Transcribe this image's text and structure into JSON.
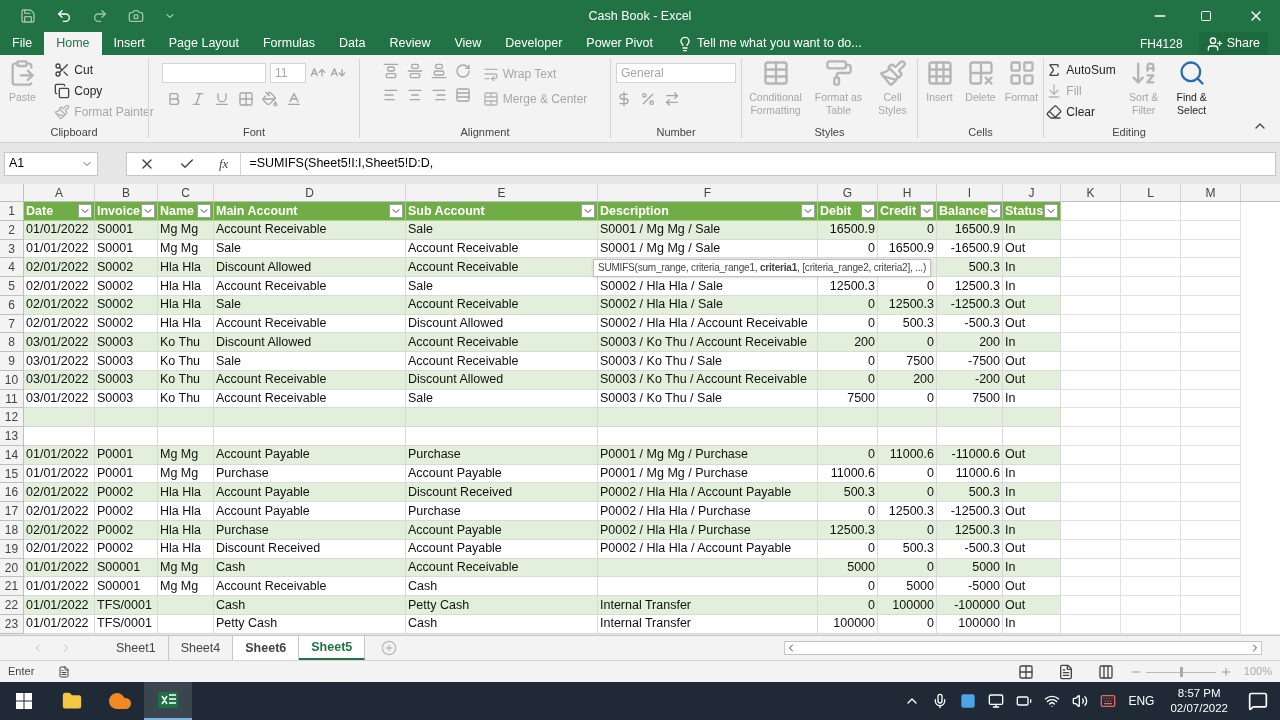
{
  "window": {
    "title": "Cash Book - Excel",
    "user": "FH4128",
    "share": "Share"
  },
  "ribbon_tabs": [
    {
      "label": "File",
      "selected": false
    },
    {
      "label": "Home",
      "selected": true
    },
    {
      "label": "Insert",
      "selected": false
    },
    {
      "label": "Page Layout",
      "selected": false
    },
    {
      "label": "Formulas",
      "selected": false
    },
    {
      "label": "Data",
      "selected": false
    },
    {
      "label": "Review",
      "selected": false
    },
    {
      "label": "View",
      "selected": false
    },
    {
      "label": "Developer",
      "selected": false
    },
    {
      "label": "Power Pivot",
      "selected": false
    }
  ],
  "tell_me": {
    "placeholder": "Tell me what you want to do..."
  },
  "ribbon": {
    "clipboard": {
      "label": "Clipboard",
      "paste": {
        "label": "Paste",
        "disabled": true
      },
      "items": [
        {
          "label": "Cut",
          "disabled": false
        },
        {
          "label": "Copy",
          "disabled": false
        },
        {
          "label": "Format Painter",
          "disabled": true
        }
      ]
    },
    "font": {
      "label": "Font",
      "size": "11"
    },
    "alignment": {
      "label": "Alignment",
      "items": [
        {
          "label": "Wrap Text",
          "disabled": true
        },
        {
          "label": "Merge & Center",
          "disabled": true
        }
      ]
    },
    "number": {
      "label": "Number",
      "format": "General"
    },
    "styles": {
      "label": "Styles",
      "items": [
        {
          "label": "Conditional Formatting",
          "disabled": true
        },
        {
          "label": "Format as Table",
          "disabled": true
        },
        {
          "label": "Cell Styles",
          "disabled": true
        }
      ]
    },
    "cells": {
      "label": "Cells",
      "items": [
        {
          "label": "Insert",
          "disabled": true
        },
        {
          "label": "Delete",
          "disabled": true
        },
        {
          "label": "Format",
          "disabled": true
        }
      ]
    },
    "editing": {
      "label": "Editing",
      "small": [
        {
          "label": "AutoSum",
          "disabled": false
        },
        {
          "label": "Fill",
          "disabled": true
        },
        {
          "label": "Clear",
          "disabled": false
        }
      ],
      "large": [
        {
          "label": "Sort & Filter",
          "disabled": true
        },
        {
          "label": "Find & Select",
          "disabled": false
        }
      ]
    }
  },
  "formula_bar": {
    "name_box": "A1",
    "fx": "fx",
    "formula": "=SUMIFS(Sheet5!I:I,Sheet5!D:D,"
  },
  "columns": [
    "A",
    "B",
    "C",
    "D",
    "E",
    "F",
    "G",
    "H",
    "I",
    "J",
    "K",
    "L",
    "M"
  ],
  "header_row": {
    "n": "1",
    "cells": [
      "Date",
      "Invoice",
      "Name",
      "Main Account",
      "Sub Account",
      "Description",
      "Debit",
      "Credit",
      "Balance",
      "Status"
    ]
  },
  "rows": [
    {
      "n": "2",
      "cells": [
        "01/01/2022",
        "S0001",
        "Mg Mg",
        "Account Receivable",
        "Sale",
        "S0001 / Mg Mg / Sale",
        "16500.9",
        "0",
        "16500.9",
        "In"
      ]
    },
    {
      "n": "3",
      "cells": [
        "01/01/2022",
        "S0001",
        "Mg Mg",
        "Sale",
        "Account Receivable",
        "S0001 / Mg Mg / Sale",
        "0",
        "16500.9",
        "-16500.9",
        "Out"
      ]
    },
    {
      "n": "4",
      "cells": [
        "02/01/2022",
        "S0002",
        "Hla Hla",
        "Discount Allowed",
        "Account Receivable",
        null,
        null,
        null,
        "500.3",
        "In"
      ]
    },
    {
      "n": "5",
      "cells": [
        "02/01/2022",
        "S0002",
        "Hla Hla",
        "Account Receivable",
        "Sale",
        "S0002 / Hla Hla / Sale",
        "12500.3",
        "0",
        "12500.3",
        "In"
      ]
    },
    {
      "n": "6",
      "cells": [
        "02/01/2022",
        "S0002",
        "Hla Hla",
        "Sale",
        "Account Receivable",
        "S0002 / Hla Hla / Sale",
        "0",
        "12500.3",
        "-12500.3",
        "Out"
      ]
    },
    {
      "n": "7",
      "cells": [
        "02/01/2022",
        "S0002",
        "Hla Hla",
        "Account Receivable",
        "Discount Allowed",
        "S0002 / Hla Hla / Account Receivable",
        "0",
        "500.3",
        "-500.3",
        "Out"
      ]
    },
    {
      "n": "8",
      "cells": [
        "03/01/2022",
        "S0003",
        "Ko Thu",
        "Discount Allowed",
        "Account Receivable",
        "S0003 / Ko Thu / Account Receivable",
        "200",
        "0",
        "200",
        "In"
      ]
    },
    {
      "n": "9",
      "cells": [
        "03/01/2022",
        "S0003",
        "Ko Thu",
        "Sale",
        "Account Receivable",
        "S0003 / Ko Thu / Sale",
        "0",
        "7500",
        "-7500",
        "Out"
      ]
    },
    {
      "n": "10",
      "cells": [
        "03/01/2022",
        "S0003",
        "Ko Thu",
        "Account Receivable",
        "Discount Allowed",
        "S0003 / Ko Thu / Account Receivable",
        "0",
        "200",
        "-200",
        "Out"
      ]
    },
    {
      "n": "11",
      "cells": [
        "03/01/2022",
        "S0003",
        "Ko Thu",
        "Account Receivable",
        "Sale",
        "S0003 / Ko Thu / Sale",
        "7500",
        "0",
        "7500",
        "In"
      ]
    },
    {
      "n": "12",
      "cells": [
        null,
        null,
        null,
        null,
        null,
        null,
        null,
        null,
        null,
        null
      ]
    },
    {
      "n": "13",
      "cells": [
        null,
        null,
        null,
        null,
        null,
        null,
        null,
        null,
        null,
        null
      ]
    },
    {
      "n": "14",
      "cells": [
        "01/01/2022",
        "P0001",
        "Mg Mg",
        "Account Payable",
        "Purchase",
        "P0001 / Mg Mg / Purchase",
        "0",
        "11000.6",
        "-11000.6",
        "Out"
      ]
    },
    {
      "n": "15",
      "cells": [
        "01/01/2022",
        "P0001",
        "Mg Mg",
        "Purchase",
        "Account Payable",
        "P0001 / Mg Mg / Purchase",
        "11000.6",
        "0",
        "11000.6",
        "In"
      ]
    },
    {
      "n": "16",
      "cells": [
        "02/01/2022",
        "P0002",
        "Hla Hla",
        "Account Payable",
        "Discount Received",
        "P0002 / Hla Hla / Account Payable",
        "500.3",
        "0",
        "500.3",
        "In"
      ]
    },
    {
      "n": "17",
      "cells": [
        "02/01/2022",
        "P0002",
        "Hla Hla",
        "Account Payable",
        "Purchase",
        "P0002 / Hla Hla / Purchase",
        "0",
        "12500.3",
        "-12500.3",
        "Out"
      ]
    },
    {
      "n": "18",
      "cells": [
        "02/01/2022",
        "P0002",
        "Hla Hla",
        "Purchase",
        "Account Payable",
        "P0002 / Hla Hla / Purchase",
        "12500.3",
        "0",
        "12500.3",
        "In"
      ]
    },
    {
      "n": "19",
      "cells": [
        "02/01/2022",
        "P0002",
        "Hla Hla",
        "Discount Received",
        "Account Payable",
        "P0002 / Hla Hla / Account Payable",
        "0",
        "500.3",
        "-500.3",
        "Out"
      ]
    },
    {
      "n": "20",
      "cells": [
        "01/01/2022",
        "S00001",
        "Mg Mg",
        "Cash",
        "Account Receivable",
        null,
        "5000",
        "0",
        "5000",
        "In"
      ]
    },
    {
      "n": "21",
      "cells": [
        "01/01/2022",
        "S00001",
        "Mg Mg",
        "Account Receivable",
        "Cash",
        null,
        "0",
        "5000",
        "-5000",
        "Out"
      ]
    },
    {
      "n": "22",
      "cells": [
        "01/01/2022",
        "TFS/0001",
        null,
        "Cash",
        "Petty Cash",
        "Internal Transfer",
        "0",
        "100000",
        "-100000",
        "Out"
      ]
    },
    {
      "n": "23",
      "cells": [
        "01/01/2022",
        "TFS/0001",
        null,
        "Petty Cash",
        "Cash",
        "Internal Transfer",
        "100000",
        "0",
        "100000",
        "In"
      ]
    }
  ],
  "tooltip": "SUMIFS(sum_range, criteria_range1, **criteria1**, [criteria_range2, criteria2], ...)",
  "sheet_tabs": [
    {
      "label": "Sheet1",
      "selected": false,
      "grouped": false
    },
    {
      "label": "Sheet4",
      "selected": false,
      "grouped": false
    },
    {
      "label": "Sheet6",
      "selected": false,
      "grouped": true
    },
    {
      "label": "Sheet5",
      "selected": true,
      "grouped": true
    }
  ],
  "status_bar": {
    "mode": "Enter",
    "zoom": {
      "label": "100%",
      "level": 0.5
    }
  },
  "taskbar": {
    "language": "ENG",
    "time": "8:57 PM",
    "date": "02/07/2022"
  }
}
